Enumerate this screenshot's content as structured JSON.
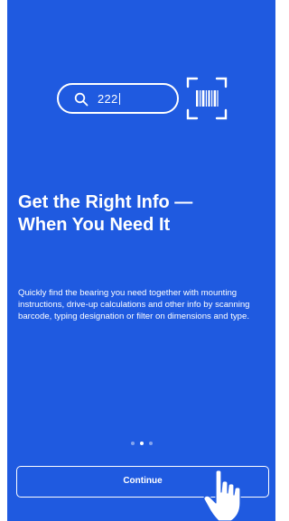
{
  "onboarding": {
    "search_query": "222",
    "title_line1": "Get the Right Info —",
    "title_line2": "When You Need It",
    "description": "Quickly find the bearing you need together with mounting instructions, drive-up calculations and other info by scanning barcode, typing designation or filter on dimensions and type.",
    "continue_label": "Continue",
    "pagination": {
      "total": 3,
      "active": 1
    }
  },
  "icons": [
    "search-icon",
    "barcode-scan-icon",
    "pointing-hand-icon"
  ],
  "colors": {
    "background": "#1f5ae0",
    "foreground": "#ffffff"
  }
}
